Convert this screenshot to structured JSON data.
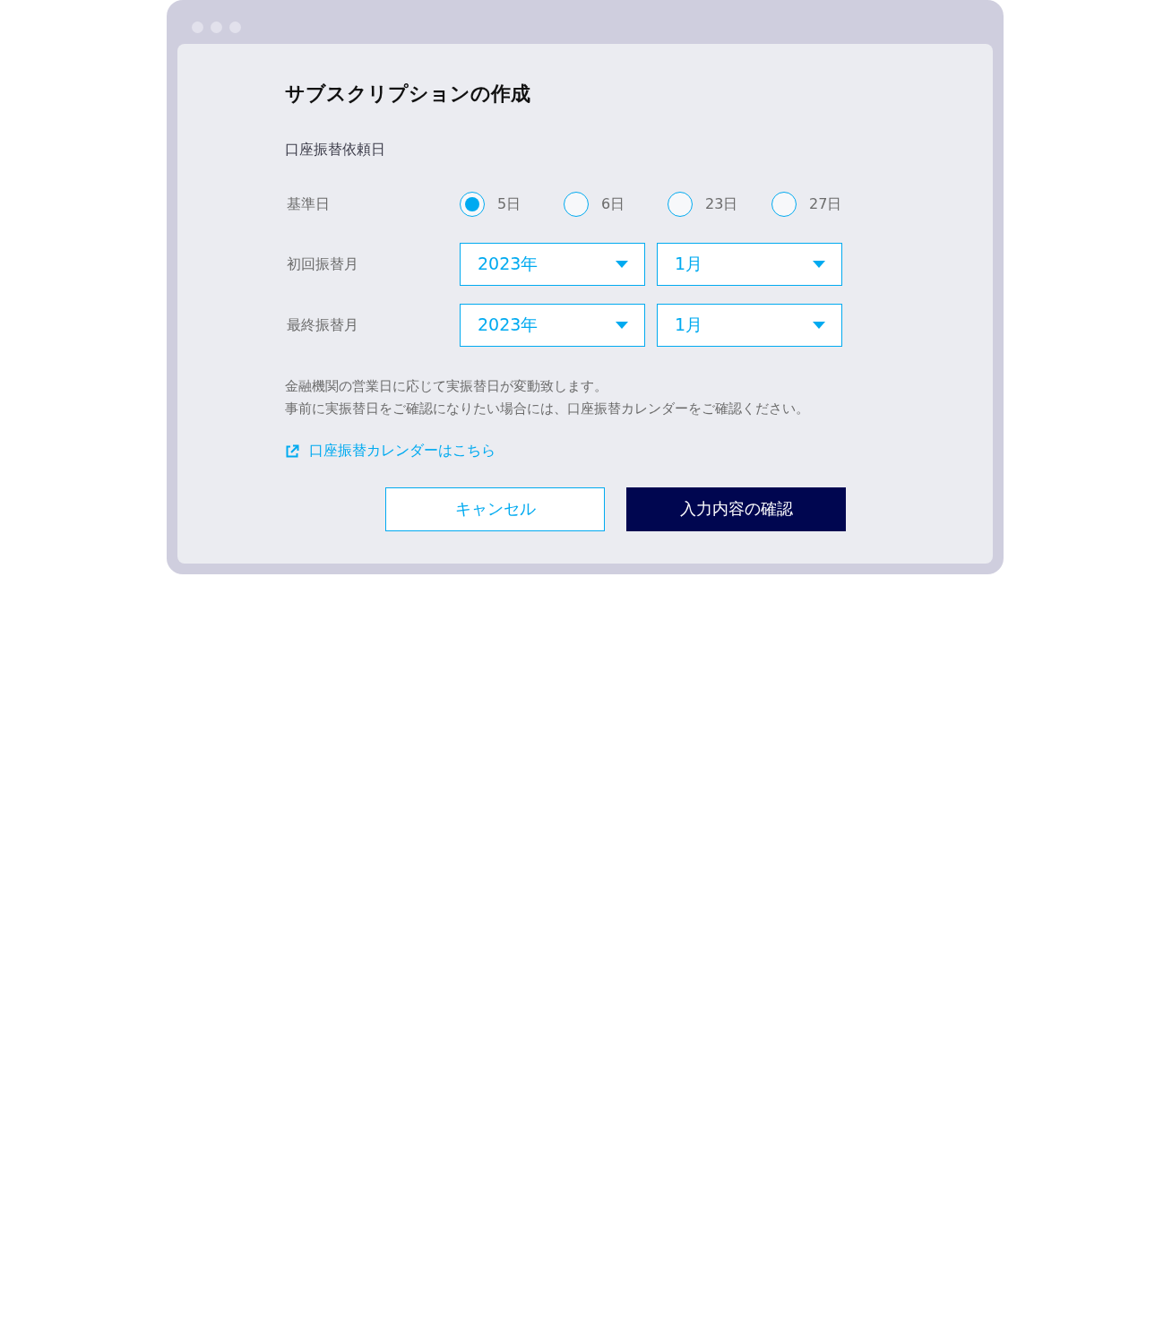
{
  "dialog": {
    "title": "サブスクリプションの作成",
    "section_label": "口座振替依頼日"
  },
  "base_day": {
    "label": "基準日",
    "options": [
      {
        "label": "5日",
        "selected": true
      },
      {
        "label": "6日",
        "selected": false
      },
      {
        "label": "23日",
        "selected": false
      },
      {
        "label": "27日",
        "selected": false
      }
    ]
  },
  "month_rows": [
    {
      "label": "初回振替月",
      "fields": [
        {
          "value": "2023年"
        },
        {
          "value": "1月"
        }
      ]
    },
    {
      "label": "最終振替月",
      "fields": [
        {
          "value": "2023年"
        },
        {
          "value": "1月"
        }
      ]
    }
  ],
  "notes": [
    "金融機関の営業日に応じて実振替日が変動致します。",
    "事前に実振替日をご確認になりたい場合には、口座振替カレンダーをご確認ください。"
  ],
  "link": {
    "label": "口座振替カレンダーはこちら"
  },
  "buttons": [
    {
      "label": "キャンセル",
      "kind": "secondary"
    },
    {
      "label": "入力内容の確認",
      "kind": "primary"
    }
  ]
}
